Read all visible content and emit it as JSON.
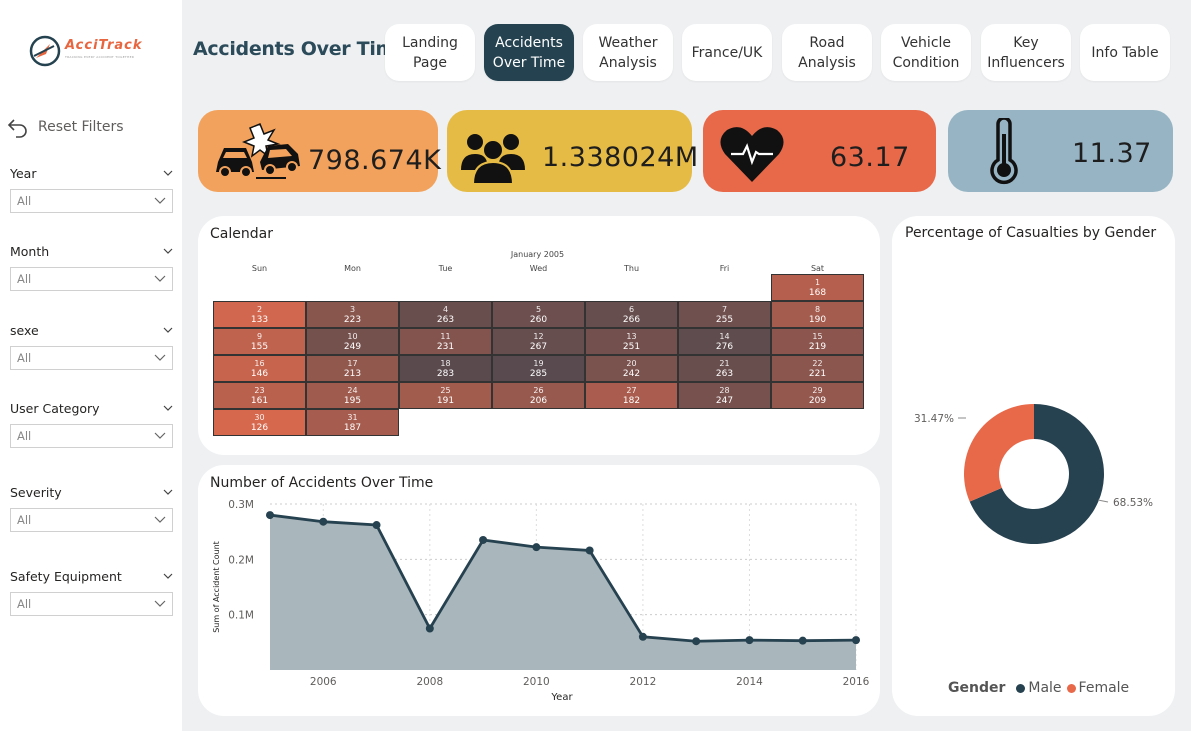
{
  "logo": {
    "brand": "AcciTrack",
    "tagline": "TRACKING EVERY ACCIDENT TOGETHER"
  },
  "sidebar": {
    "reset_label": "Reset Filters",
    "slicers": [
      {
        "label": "Year",
        "value": "All"
      },
      {
        "label": "Month",
        "value": "All"
      },
      {
        "label": "sexe",
        "value": "All"
      },
      {
        "label": "User Category",
        "value": "All"
      },
      {
        "label": "Severity",
        "value": "All"
      },
      {
        "label": "Safety Equipment",
        "value": "All"
      }
    ]
  },
  "header": {
    "title": "Accidents Over Time",
    "tabs": [
      {
        "label": "Landing Page",
        "active": false
      },
      {
        "label": "Accidents Over Time",
        "active": true
      },
      {
        "label": "Weather Analysis",
        "active": false
      },
      {
        "label": "France/UK",
        "active": false
      },
      {
        "label": "Road Analysis",
        "active": false
      },
      {
        "label": "Vehicle Condition",
        "active": false
      },
      {
        "label": "Key Influencers",
        "active": false
      },
      {
        "label": "Info Table",
        "active": false
      }
    ]
  },
  "kpis": [
    {
      "icon": "car-crash-icon",
      "value": "798.674K",
      "color": "#f2a25c"
    },
    {
      "icon": "people-icon",
      "value": "1.338024M",
      "color": "#e6bb45"
    },
    {
      "icon": "heartbeat-icon",
      "value": "63.17",
      "color": "#e8694a"
    },
    {
      "icon": "thermometer-icon",
      "value": "11.37",
      "color": "#97b4c4"
    }
  ],
  "calendar": {
    "title": "Calendar",
    "month_label": "January 2005",
    "days_of_week": [
      "Sun",
      "Mon",
      "Tue",
      "Wed",
      "Thu",
      "Fri",
      "Sat"
    ],
    "weeks": [
      [
        null,
        null,
        null,
        null,
        null,
        null,
        {
          "day": "1",
          "value": "168"
        }
      ],
      [
        {
          "day": "2",
          "value": "133"
        },
        {
          "day": "3",
          "value": "223"
        },
        {
          "day": "4",
          "value": "263"
        },
        {
          "day": "5",
          "value": "260"
        },
        {
          "day": "6",
          "value": "266"
        },
        {
          "day": "7",
          "value": "255"
        },
        {
          "day": "8",
          "value": "190"
        }
      ],
      [
        {
          "day": "9",
          "value": "155"
        },
        {
          "day": "10",
          "value": "249"
        },
        {
          "day": "11",
          "value": "231"
        },
        {
          "day": "12",
          "value": "267"
        },
        {
          "day": "13",
          "value": "251"
        },
        {
          "day": "14",
          "value": "276"
        },
        {
          "day": "15",
          "value": "219"
        }
      ],
      [
        {
          "day": "16",
          "value": "146"
        },
        {
          "day": "17",
          "value": "213"
        },
        {
          "day": "18",
          "value": "283"
        },
        {
          "day": "19",
          "value": "285"
        },
        {
          "day": "20",
          "value": "242"
        },
        {
          "day": "21",
          "value": "263"
        },
        {
          "day": "22",
          "value": "221"
        }
      ],
      [
        {
          "day": "23",
          "value": "161"
        },
        {
          "day": "24",
          "value": "195"
        },
        {
          "day": "25",
          "value": "191"
        },
        {
          "day": "26",
          "value": "206"
        },
        {
          "day": "27",
          "value": "182"
        },
        {
          "day": "28",
          "value": "247"
        },
        {
          "day": "29",
          "value": "209"
        }
      ],
      [
        {
          "day": "30",
          "value": "126"
        },
        {
          "day": "31",
          "value": "187"
        },
        null,
        null,
        null,
        null,
        null
      ]
    ]
  },
  "chart_data": [
    {
      "type": "area",
      "title": "Number of Accidents Over Time",
      "xlabel": "Year",
      "ylabel": "Sum of Accident Count",
      "x": [
        2005,
        2006,
        2007,
        2008,
        2009,
        2010,
        2011,
        2012,
        2013,
        2014,
        2015,
        2016
      ],
      "values": [
        280000,
        268000,
        262000,
        75000,
        235000,
        222000,
        216000,
        60000,
        52000,
        54000,
        53000,
        54000
      ],
      "ylim": [
        0,
        300000
      ],
      "xlim": [
        2005,
        2016
      ],
      "yticks": [
        "0.1M",
        "0.2M",
        "0.3M"
      ],
      "ytick_values": [
        100000,
        200000,
        300000
      ],
      "xticks": [
        "2006",
        "2008",
        "2010",
        "2012",
        "2014",
        "2016"
      ],
      "xtick_values": [
        2006,
        2008,
        2010,
        2012,
        2014,
        2016
      ],
      "grid": true,
      "colors": {
        "line": "#26414f",
        "area": "#a9b6bb"
      }
    },
    {
      "type": "pie",
      "title": "Percentage of Casualties by Gender",
      "legend_title": "Gender",
      "categories": [
        "Male",
        "Female"
      ],
      "values": [
        68.53,
        31.47
      ],
      "labels": [
        "68.53%",
        "31.47%"
      ],
      "colors": [
        "#26414f",
        "#e8694a"
      ],
      "legend_position": "bottom"
    }
  ]
}
